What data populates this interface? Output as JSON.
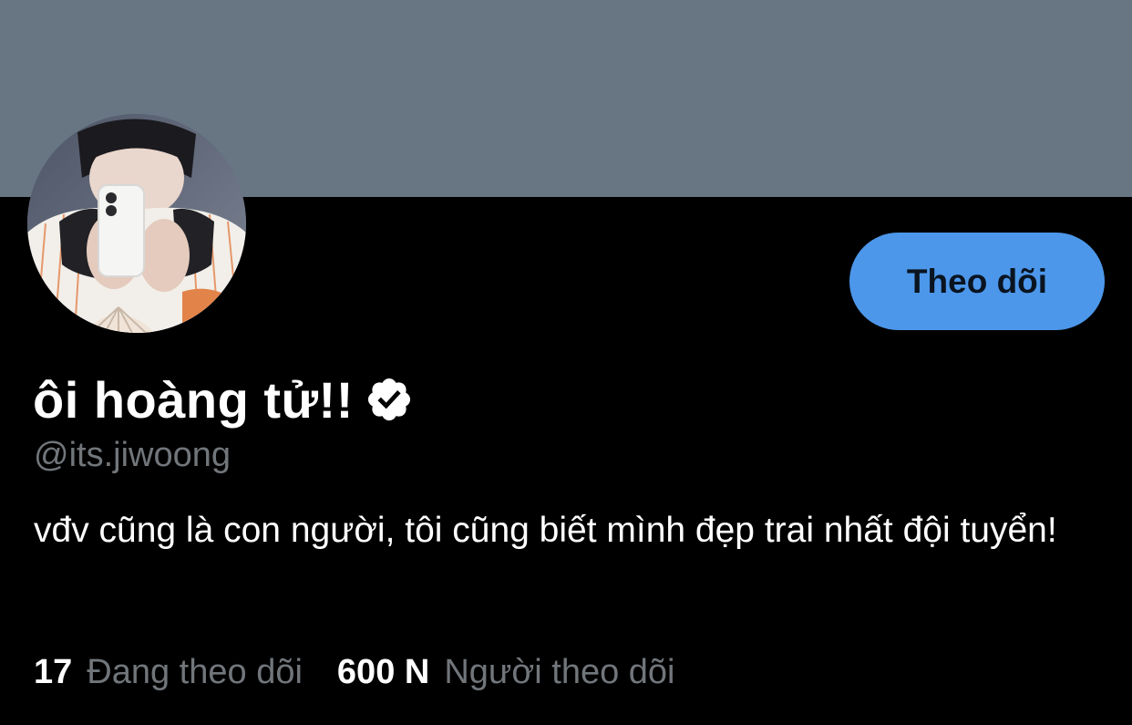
{
  "colors": {
    "banner": "#687684",
    "background": "#000000",
    "follow_button": "#4c97ea",
    "muted_text": "#71767b",
    "primary_text": "#ffffff"
  },
  "profile": {
    "display_name": "ôi hoàng tử!!",
    "verified_icon": "verified-badge-icon",
    "handle": "@its.jiwoong",
    "bio": "vđv cũng là con người, tôi cũng biết mình đẹp trai nhất đội tuyển!"
  },
  "actions": {
    "follow_label": "Theo dõi"
  },
  "stats": {
    "following_count": "17",
    "following_label": "Đang theo dõi",
    "followers_count": "600 N",
    "followers_label": "Người theo dõi"
  }
}
